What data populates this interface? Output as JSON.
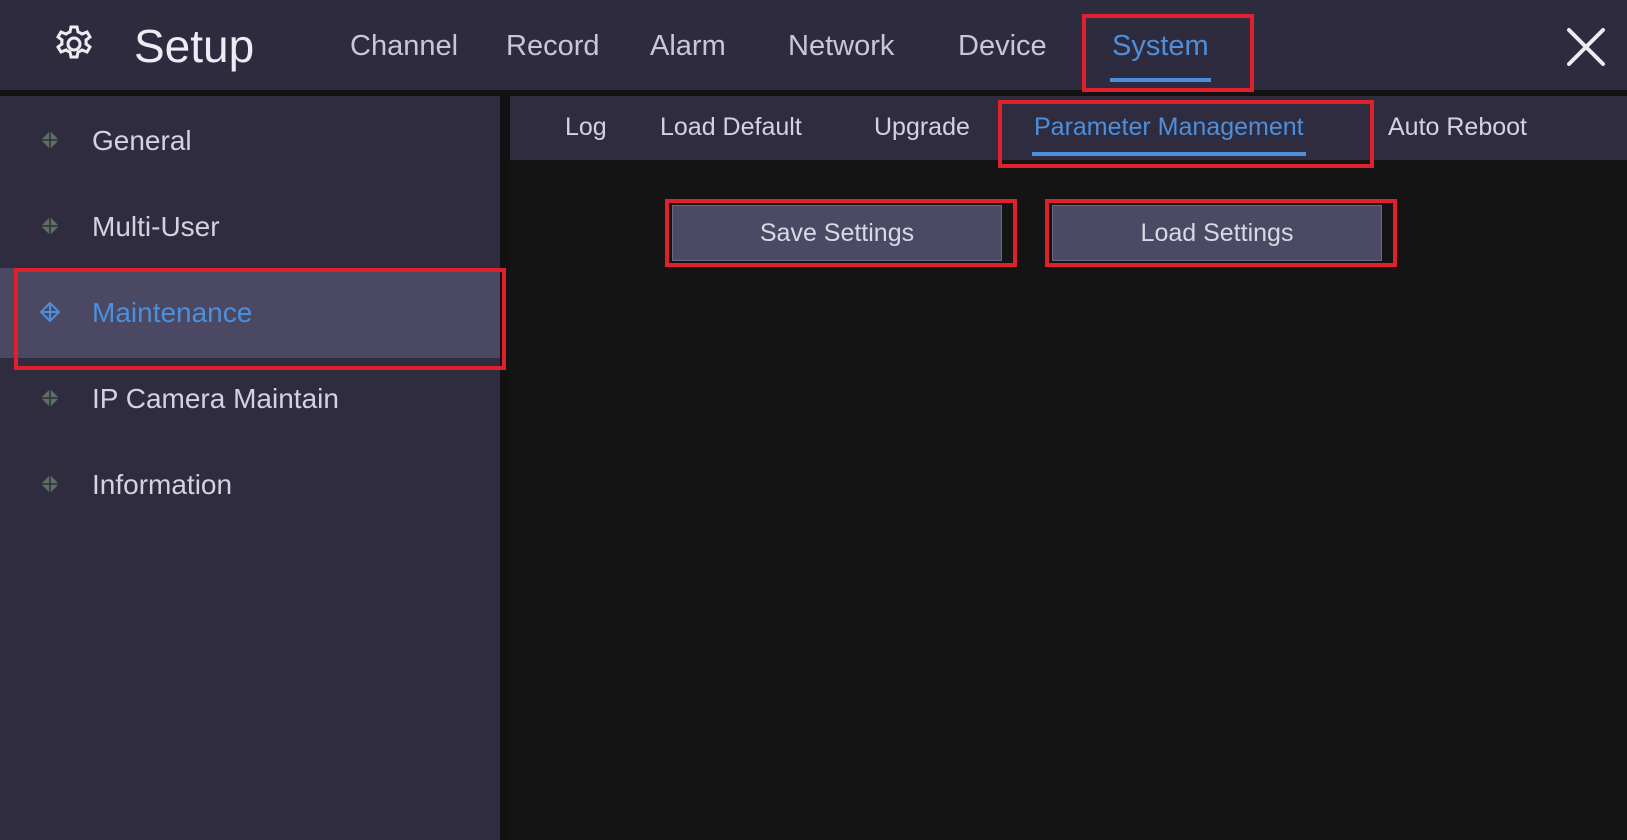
{
  "header": {
    "title": "Setup",
    "tabs": [
      {
        "label": "Channel",
        "active": false
      },
      {
        "label": "Record",
        "active": false
      },
      {
        "label": "Alarm",
        "active": false
      },
      {
        "label": "Network",
        "active": false
      },
      {
        "label": "Device",
        "active": false
      },
      {
        "label": "System",
        "active": true
      }
    ],
    "icons": {
      "settings": "gear-icon",
      "close": "close-icon"
    }
  },
  "sidebar": {
    "items": [
      {
        "label": "General",
        "active": false
      },
      {
        "label": "Multi-User",
        "active": false
      },
      {
        "label": "Maintenance",
        "active": true
      },
      {
        "label": "IP Camera Maintain",
        "active": false
      },
      {
        "label": "Information",
        "active": false
      }
    ],
    "item_icon": "diamond-marker-icon"
  },
  "subtabs": [
    {
      "label": "Log",
      "active": false
    },
    {
      "label": "Load Default",
      "active": false
    },
    {
      "label": "Upgrade",
      "active": false
    },
    {
      "label": "Parameter Management",
      "active": true
    },
    {
      "label": "Auto Reboot",
      "active": false
    }
  ],
  "actions": {
    "save_label": "Save Settings",
    "load_label": "Load Settings"
  },
  "colors": {
    "accent": "#4c8fdc",
    "highlight": "#e0202a",
    "panel": "#2f2c40",
    "background": "#121212"
  }
}
